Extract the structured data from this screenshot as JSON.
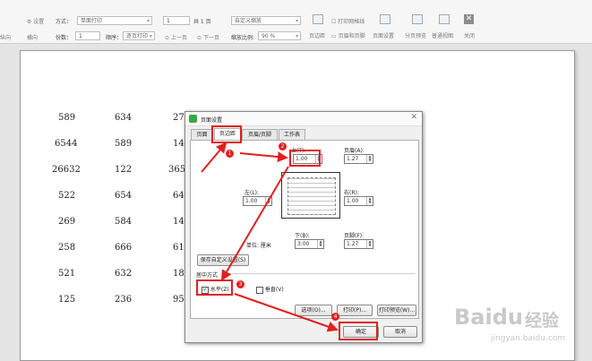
{
  "ribbon": {
    "left_labels": [
      "纵向",
      "横向"
    ],
    "settings_label": "设置",
    "method_label": "方式：",
    "method_value": "单面打印",
    "copies_label": "份数：",
    "copies_value": "1",
    "order_label": "顺序：",
    "order_value": "逐页打印",
    "page_value": "1",
    "page_total": "共 1 页",
    "prev_page": "上一页",
    "next_page": "下一页",
    "scale_type": "自定义缩放",
    "scale_label": "缩放比例:",
    "scale_value": "90 %",
    "print_gridlines": "打印网格线",
    "margins_btn": "页边距",
    "header_footer_btn": "页眉和页脚",
    "page_setup_btn": "页面设置",
    "split_preview_btn": "分页预览",
    "normal_view_btn": "普通视图",
    "close_btn": "关闭"
  },
  "sheet": {
    "col1": [
      "589",
      "6544",
      "26632",
      "522",
      "269",
      "258",
      "521",
      "125"
    ],
    "col2": [
      "634",
      "589",
      "122",
      "654",
      "584",
      "666",
      "632",
      "236"
    ],
    "col3": [
      "27",
      "14",
      "365",
      "64",
      "14",
      "61",
      "18",
      "95"
    ]
  },
  "dialog": {
    "title": "页面设置",
    "tabs": [
      "页面",
      "页边距",
      "页眉/页脚",
      "工作表"
    ],
    "top_label": "上(T):",
    "top_value": "1.00",
    "header_label": "页眉(A):",
    "header_value": "1.27",
    "left_label": "左(L):",
    "left_value": "1.00",
    "right_label": "右(R):",
    "right_value": "1.00",
    "unit_label": "单位: 厘米",
    "bottom_label": "下(B):",
    "bottom_value": "3.00",
    "footer_label": "页脚(F):",
    "footer_value": "1.27",
    "save_custom": "保存自定义设置(S)",
    "center_section": "居中方式",
    "horizontal_label": "水平(Z)",
    "vertical_label": "垂直(V)",
    "options_btn": "选项(O)...",
    "print_btn": "打印(P)...",
    "print_preview_btn": "打印预览(W)...",
    "ok_btn": "确定",
    "cancel_btn": "取消"
  },
  "annotations": [
    "1",
    "2",
    "3",
    "4"
  ],
  "watermark": {
    "brand": "Baidu",
    "cn": "经验",
    "url": "jingyan.baidu.com"
  },
  "colors": {
    "accent": "#e02020",
    "green_logo": "#39a845"
  }
}
